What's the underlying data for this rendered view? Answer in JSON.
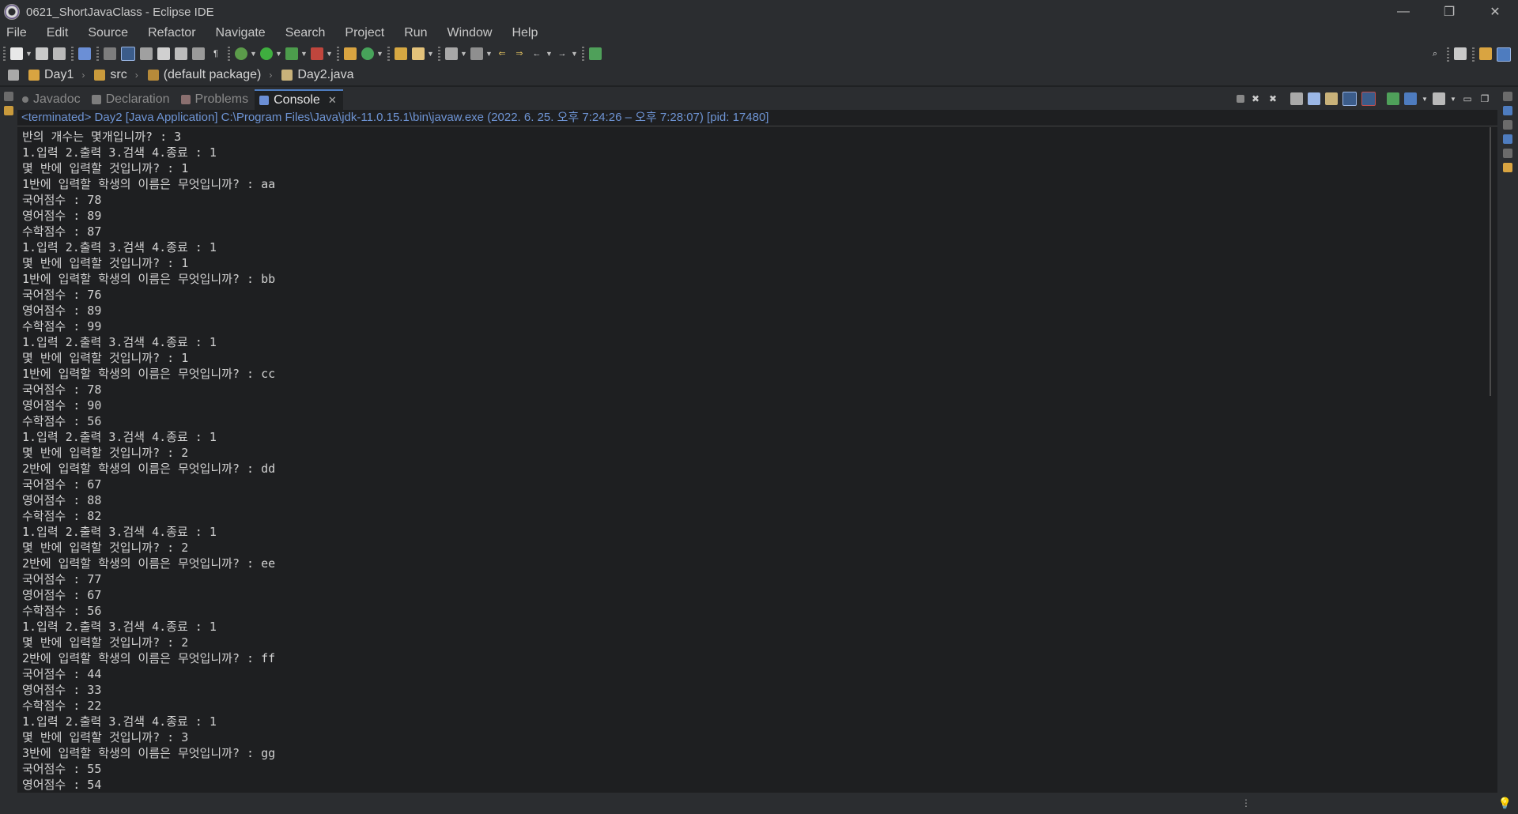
{
  "window": {
    "title": "0621_ShortJavaClass - Eclipse IDE",
    "minimize": "—",
    "restore": "❐",
    "close": "✕"
  },
  "menu": [
    "File",
    "Edit",
    "Source",
    "Refactor",
    "Navigate",
    "Search",
    "Project",
    "Run",
    "Window",
    "Help"
  ],
  "breadcrumb": {
    "project": "Day1",
    "folder": "src",
    "package": "(default package)",
    "file": "Day2.java"
  },
  "tabs": {
    "javadoc": "Javadoc",
    "declaration": "Declaration",
    "problems": "Problems",
    "console": "Console"
  },
  "console": {
    "header": "<terminated> Day2 [Java Application] C:\\Program Files\\Java\\jdk-11.0.15.1\\bin\\javaw.exe  (2022. 6. 25. 오후 7:24:26 – 오후 7:28:07) [pid: 17480]",
    "lines": [
      "반의 개수는 몇개입니까? : 3",
      "1.입력 2.출력 3.검색 4.종료 : 1",
      "몇 반에 입력할 것입니까? : 1",
      "1반에 입력할 학생의 이름은 무엇입니까? : aa",
      "국어점수 : 78",
      "영어점수 : 89",
      "수학점수 : 87",
      "1.입력 2.출력 3.검색 4.종료 : 1",
      "몇 반에 입력할 것입니까? : 1",
      "1반에 입력할 학생의 이름은 무엇입니까? : bb",
      "국어점수 : 76",
      "영어점수 : 89",
      "수학점수 : 99",
      "1.입력 2.출력 3.검색 4.종료 : 1",
      "몇 반에 입력할 것입니까? : 1",
      "1반에 입력할 학생의 이름은 무엇입니까? : cc",
      "국어점수 : 78",
      "영어점수 : 90",
      "수학점수 : 56",
      "1.입력 2.출력 3.검색 4.종료 : 1",
      "몇 반에 입력할 것입니까? : 2",
      "2반에 입력할 학생의 이름은 무엇입니까? : dd",
      "국어점수 : 67",
      "영어점수 : 88",
      "수학점수 : 82",
      "1.입력 2.출력 3.검색 4.종료 : 1",
      "몇 반에 입력할 것입니까? : 2",
      "2반에 입력할 학생의 이름은 무엇입니까? : ee",
      "국어점수 : 77",
      "영어점수 : 67",
      "수학점수 : 56",
      "1.입력 2.출력 3.검색 4.종료 : 1",
      "몇 반에 입력할 것입니까? : 2",
      "2반에 입력할 학생의 이름은 무엇입니까? : ff",
      "국어점수 : 44",
      "영어점수 : 33",
      "수학점수 : 22",
      "1.입력 2.출력 3.검색 4.종료 : 1",
      "몇 반에 입력할 것입니까? : 3",
      "3반에 입력할 학생의 이름은 무엇입니까? : gg",
      "국어점수 : 55",
      "영어점수 : 54"
    ]
  },
  "colors": {
    "background": "#1e1f21",
    "chrome": "#2b2d30",
    "header_link": "#6e94d4",
    "text": "#d2d2d2"
  }
}
